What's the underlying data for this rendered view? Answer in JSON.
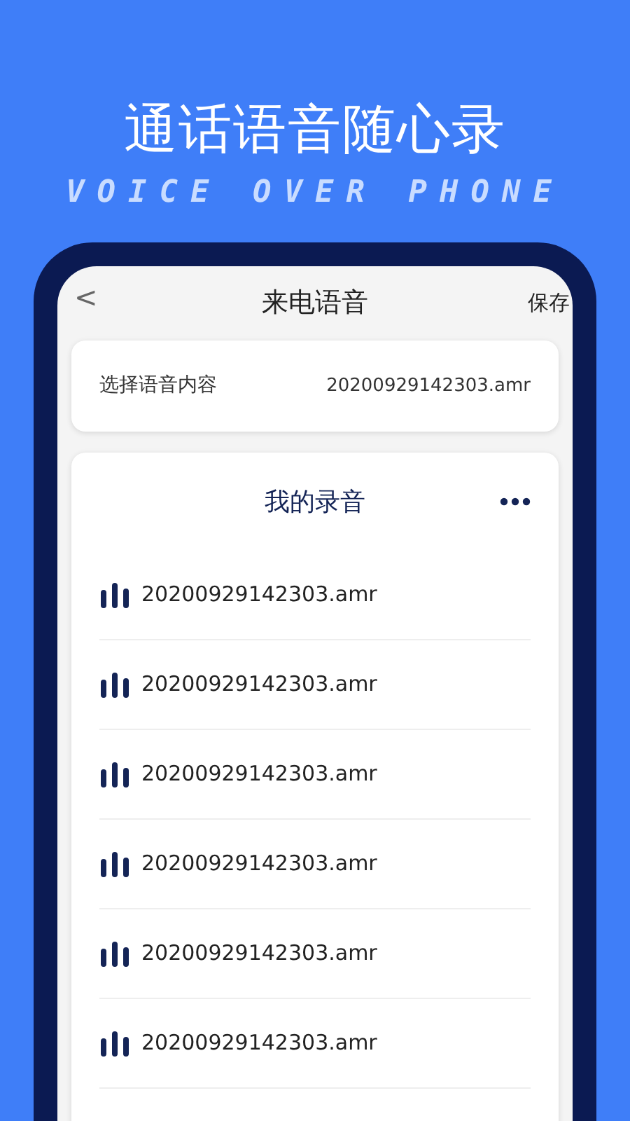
{
  "headline": "通话语音随心录",
  "tagline": "VOICE OVER PHONE",
  "screen": {
    "back": "<",
    "title": "来电语音",
    "action": "保存",
    "select_card": {
      "label": "选择语音内容",
      "value": "20200929142303.amr"
    },
    "recordings": {
      "title": "我的录音",
      "items": [
        {
          "name": "20200929142303.amr"
        },
        {
          "name": "20200929142303.amr"
        },
        {
          "name": "20200929142303.amr"
        },
        {
          "name": "20200929142303.amr"
        },
        {
          "name": "20200929142303.amr"
        },
        {
          "name": "20200929142303.amr"
        }
      ]
    }
  }
}
